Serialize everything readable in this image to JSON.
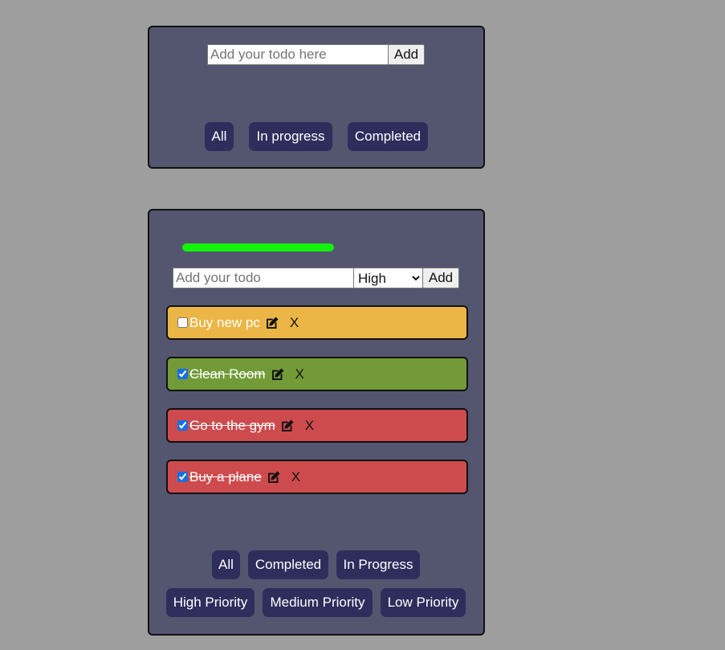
{
  "colors": {
    "background": "#9e9e9e",
    "panel": "#545670",
    "filter_button": "#2f2d5c",
    "progress": "#13f20b",
    "priority_medium": "#ebb645",
    "priority_low": "#729b37",
    "priority_high": "#ce4b4d"
  },
  "form1": {
    "placeholder": "Add your todo here",
    "value": "",
    "add_label": "Add",
    "filters": [
      "All",
      "In progress",
      "Completed"
    ]
  },
  "form2": {
    "progress_fraction": 0.75,
    "placeholder": "Add your todo",
    "value": "",
    "priority_selected": "High",
    "add_label": "Add",
    "todos": [
      {
        "text": "Buy new pc",
        "done": false,
        "priority": "medium",
        "delete_label": "X",
        "icon": "edit-icon"
      },
      {
        "text": "Clean Room",
        "done": true,
        "priority": "low",
        "delete_label": "X",
        "icon": "edit-icon"
      },
      {
        "text": "Go to the gym",
        "done": true,
        "priority": "high",
        "delete_label": "X",
        "icon": "edit-icon"
      },
      {
        "text": "Buy a plane",
        "done": true,
        "priority": "high",
        "delete_label": "X",
        "icon": "edit-icon"
      }
    ],
    "filters_row1": [
      "All",
      "Completed",
      "In Progress"
    ],
    "filters_row2": [
      "High Priority",
      "Medium Priority",
      "Low Priority"
    ]
  }
}
